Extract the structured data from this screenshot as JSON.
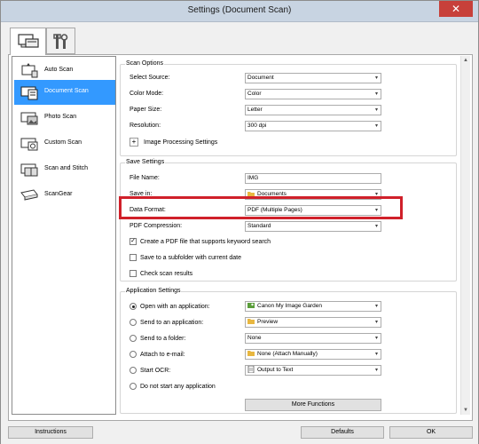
{
  "window": {
    "title": "Settings (Document Scan)",
    "close_glyph": "✕"
  },
  "tabs": [
    {
      "name": "scan-settings-tab"
    },
    {
      "name": "general-settings-tab"
    }
  ],
  "sidebar": {
    "items": [
      {
        "label": "Auto Scan",
        "icon": "auto-scan-icon"
      },
      {
        "label": "Document Scan",
        "icon": "document-scan-icon",
        "selected": true
      },
      {
        "label": "Photo Scan",
        "icon": "photo-scan-icon"
      },
      {
        "label": "Custom Scan",
        "icon": "custom-scan-icon"
      },
      {
        "label": "Scan and Stitch",
        "icon": "scan-and-stitch-icon"
      },
      {
        "label": "ScanGear",
        "icon": "scangear-icon"
      }
    ]
  },
  "scan_options": {
    "title": "Scan Options",
    "select_source": {
      "label": "Select Source:",
      "value": "Document"
    },
    "color_mode": {
      "label": "Color Mode:",
      "value": "Color"
    },
    "paper_size": {
      "label": "Paper Size:",
      "value": "Letter"
    },
    "resolution": {
      "label": "Resolution:",
      "value": "300 dpi"
    },
    "image_processing": {
      "expander": "+",
      "label": "Image Processing Settings"
    }
  },
  "save_settings": {
    "title": "Save Settings",
    "file_name": {
      "label": "File Name:",
      "value": "IMG"
    },
    "save_in": {
      "label": "Save in:",
      "value": "Documents"
    },
    "data_format": {
      "label": "Data Format:",
      "value": "PDF (Multiple Pages)"
    },
    "pdf_compression": {
      "label": "PDF Compression:",
      "value": "Standard"
    },
    "keyword_search": {
      "label": "Create a PDF file that supports keyword search",
      "checked": true
    },
    "subfolder": {
      "label": "Save to a subfolder with current date",
      "checked": false
    },
    "check_results": {
      "label": "Check scan results",
      "checked": false
    }
  },
  "application_settings": {
    "title": "Application Settings",
    "options": [
      {
        "label": "Open with an application:",
        "value": "Canon My Image Garden",
        "selected": true
      },
      {
        "label": "Send to an application:",
        "value": "Preview",
        "selected": false
      },
      {
        "label": "Send to a folder:",
        "value": "None",
        "selected": false
      },
      {
        "label": "Attach to e-mail:",
        "value": "None (Attach Manually)",
        "selected": false
      },
      {
        "label": "Start OCR:",
        "value": "Output to Text",
        "selected": false
      },
      {
        "label": "Do not start any application",
        "value": null,
        "selected": false
      }
    ],
    "more_functions": "More Functions"
  },
  "footer": {
    "instructions": "Instructions",
    "defaults": "Defaults",
    "ok": "OK"
  },
  "colors": {
    "highlight": "#d0202a",
    "selection": "#3399ff",
    "titlebar": "#c8d4e2",
    "close": "#c7403a"
  }
}
